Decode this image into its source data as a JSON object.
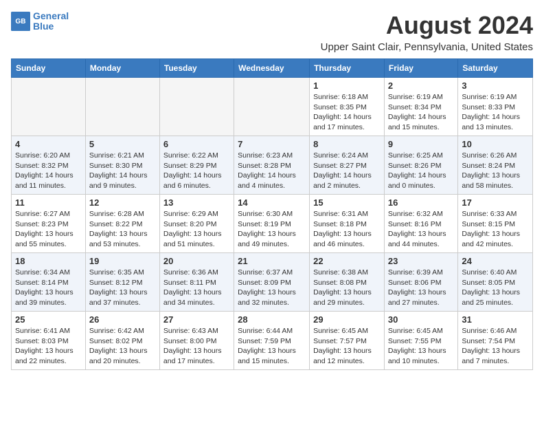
{
  "header": {
    "logo_line1": "General",
    "logo_line2": "Blue",
    "title": "August 2024",
    "subtitle": "Upper Saint Clair, Pennsylvania, United States"
  },
  "weekdays": [
    "Sunday",
    "Monday",
    "Tuesday",
    "Wednesday",
    "Thursday",
    "Friday",
    "Saturday"
  ],
  "weeks": [
    {
      "days": [
        {
          "number": "",
          "empty": true
        },
        {
          "number": "",
          "empty": true
        },
        {
          "number": "",
          "empty": true
        },
        {
          "number": "",
          "empty": true
        },
        {
          "number": "1",
          "sunrise": "Sunrise: 6:18 AM",
          "sunset": "Sunset: 8:35 PM",
          "daylight": "Daylight: 14 hours and 17 minutes."
        },
        {
          "number": "2",
          "sunrise": "Sunrise: 6:19 AM",
          "sunset": "Sunset: 8:34 PM",
          "daylight": "Daylight: 14 hours and 15 minutes."
        },
        {
          "number": "3",
          "sunrise": "Sunrise: 6:19 AM",
          "sunset": "Sunset: 8:33 PM",
          "daylight": "Daylight: 14 hours and 13 minutes."
        }
      ]
    },
    {
      "days": [
        {
          "number": "4",
          "sunrise": "Sunrise: 6:20 AM",
          "sunset": "Sunset: 8:32 PM",
          "daylight": "Daylight: 14 hours and 11 minutes."
        },
        {
          "number": "5",
          "sunrise": "Sunrise: 6:21 AM",
          "sunset": "Sunset: 8:30 PM",
          "daylight": "Daylight: 14 hours and 9 minutes."
        },
        {
          "number": "6",
          "sunrise": "Sunrise: 6:22 AM",
          "sunset": "Sunset: 8:29 PM",
          "daylight": "Daylight: 14 hours and 6 minutes."
        },
        {
          "number": "7",
          "sunrise": "Sunrise: 6:23 AM",
          "sunset": "Sunset: 8:28 PM",
          "daylight": "Daylight: 14 hours and 4 minutes."
        },
        {
          "number": "8",
          "sunrise": "Sunrise: 6:24 AM",
          "sunset": "Sunset: 8:27 PM",
          "daylight": "Daylight: 14 hours and 2 minutes."
        },
        {
          "number": "9",
          "sunrise": "Sunrise: 6:25 AM",
          "sunset": "Sunset: 8:26 PM",
          "daylight": "Daylight: 14 hours and 0 minutes."
        },
        {
          "number": "10",
          "sunrise": "Sunrise: 6:26 AM",
          "sunset": "Sunset: 8:24 PM",
          "daylight": "Daylight: 13 hours and 58 minutes."
        }
      ]
    },
    {
      "days": [
        {
          "number": "11",
          "sunrise": "Sunrise: 6:27 AM",
          "sunset": "Sunset: 8:23 PM",
          "daylight": "Daylight: 13 hours and 55 minutes."
        },
        {
          "number": "12",
          "sunrise": "Sunrise: 6:28 AM",
          "sunset": "Sunset: 8:22 PM",
          "daylight": "Daylight: 13 hours and 53 minutes."
        },
        {
          "number": "13",
          "sunrise": "Sunrise: 6:29 AM",
          "sunset": "Sunset: 8:20 PM",
          "daylight": "Daylight: 13 hours and 51 minutes."
        },
        {
          "number": "14",
          "sunrise": "Sunrise: 6:30 AM",
          "sunset": "Sunset: 8:19 PM",
          "daylight": "Daylight: 13 hours and 49 minutes."
        },
        {
          "number": "15",
          "sunrise": "Sunrise: 6:31 AM",
          "sunset": "Sunset: 8:18 PM",
          "daylight": "Daylight: 13 hours and 46 minutes."
        },
        {
          "number": "16",
          "sunrise": "Sunrise: 6:32 AM",
          "sunset": "Sunset: 8:16 PM",
          "daylight": "Daylight: 13 hours and 44 minutes."
        },
        {
          "number": "17",
          "sunrise": "Sunrise: 6:33 AM",
          "sunset": "Sunset: 8:15 PM",
          "daylight": "Daylight: 13 hours and 42 minutes."
        }
      ]
    },
    {
      "days": [
        {
          "number": "18",
          "sunrise": "Sunrise: 6:34 AM",
          "sunset": "Sunset: 8:14 PM",
          "daylight": "Daylight: 13 hours and 39 minutes."
        },
        {
          "number": "19",
          "sunrise": "Sunrise: 6:35 AM",
          "sunset": "Sunset: 8:12 PM",
          "daylight": "Daylight: 13 hours and 37 minutes."
        },
        {
          "number": "20",
          "sunrise": "Sunrise: 6:36 AM",
          "sunset": "Sunset: 8:11 PM",
          "daylight": "Daylight: 13 hours and 34 minutes."
        },
        {
          "number": "21",
          "sunrise": "Sunrise: 6:37 AM",
          "sunset": "Sunset: 8:09 PM",
          "daylight": "Daylight: 13 hours and 32 minutes."
        },
        {
          "number": "22",
          "sunrise": "Sunrise: 6:38 AM",
          "sunset": "Sunset: 8:08 PM",
          "daylight": "Daylight: 13 hours and 29 minutes."
        },
        {
          "number": "23",
          "sunrise": "Sunrise: 6:39 AM",
          "sunset": "Sunset: 8:06 PM",
          "daylight": "Daylight: 13 hours and 27 minutes."
        },
        {
          "number": "24",
          "sunrise": "Sunrise: 6:40 AM",
          "sunset": "Sunset: 8:05 PM",
          "daylight": "Daylight: 13 hours and 25 minutes."
        }
      ]
    },
    {
      "days": [
        {
          "number": "25",
          "sunrise": "Sunrise: 6:41 AM",
          "sunset": "Sunset: 8:03 PM",
          "daylight": "Daylight: 13 hours and 22 minutes."
        },
        {
          "number": "26",
          "sunrise": "Sunrise: 6:42 AM",
          "sunset": "Sunset: 8:02 PM",
          "daylight": "Daylight: 13 hours and 20 minutes."
        },
        {
          "number": "27",
          "sunrise": "Sunrise: 6:43 AM",
          "sunset": "Sunset: 8:00 PM",
          "daylight": "Daylight: 13 hours and 17 minutes."
        },
        {
          "number": "28",
          "sunrise": "Sunrise: 6:44 AM",
          "sunset": "Sunset: 7:59 PM",
          "daylight": "Daylight: 13 hours and 15 minutes."
        },
        {
          "number": "29",
          "sunrise": "Sunrise: 6:45 AM",
          "sunset": "Sunset: 7:57 PM",
          "daylight": "Daylight: 13 hours and 12 minutes."
        },
        {
          "number": "30",
          "sunrise": "Sunrise: 6:45 AM",
          "sunset": "Sunset: 7:55 PM",
          "daylight": "Daylight: 13 hours and 10 minutes."
        },
        {
          "number": "31",
          "sunrise": "Sunrise: 6:46 AM",
          "sunset": "Sunset: 7:54 PM",
          "daylight": "Daylight: 13 hours and 7 minutes."
        }
      ]
    }
  ]
}
